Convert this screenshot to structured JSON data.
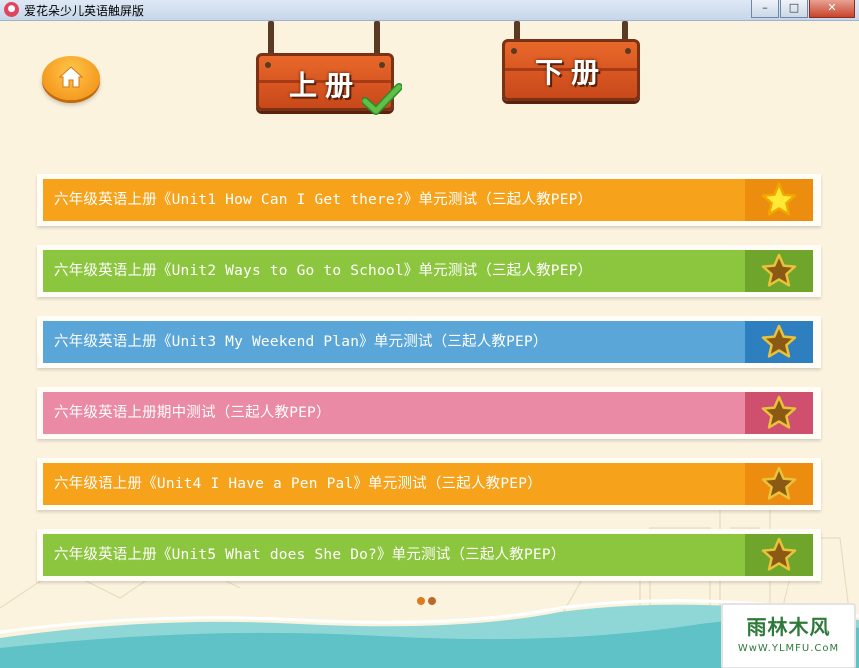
{
  "window": {
    "title": "爱花朵少儿英语触屏版",
    "minimize": "–",
    "maximize": "□",
    "close": "✕"
  },
  "books": {
    "upper": {
      "label": "上册",
      "selected": true
    },
    "lower": {
      "label": "下册",
      "selected": false
    }
  },
  "tests": [
    {
      "title": "六年级英语上册《Unit1 How Can I Get there?》单元测试（三起人教PEP）",
      "color": "#f7a21b",
      "star_bg": "#ec8d10",
      "starred": true
    },
    {
      "title": "六年级英语上册《Unit2 Ways to Go to School》单元测试（三起人教PEP）",
      "color": "#8cc63f",
      "star_bg": "#6fa52b",
      "starred": false
    },
    {
      "title": "六年级英语上册《Unit3 My Weekend Plan》单元测试（三起人教PEP）",
      "color": "#5aa6d8",
      "star_bg": "#2e7fc0",
      "starred": false
    },
    {
      "title": "六年级英语上册期中测试（三起人教PEP）",
      "color": "#ea8aa4",
      "star_bg": "#cf4f6e",
      "starred": false
    },
    {
      "title": "六年级语上册《Unit4 I Have a Pen Pal》单元测试（三起人教PEP）",
      "color": "#f7a21b",
      "star_bg": "#ec8d10",
      "starred": false
    },
    {
      "title": "六年级英语上册《Unit5 What does She Do?》单元测试（三起人教PEP）",
      "color": "#8cc63f",
      "star_bg": "#6fa52b",
      "starred": false
    }
  ],
  "pagination": {
    "active_color": "#e07a1a",
    "inactive_color": "#b96a2a"
  },
  "watermark": {
    "main": "雨林木风",
    "sub": "WwW.YLMFU.CoM"
  },
  "icons": {
    "home": "home-icon",
    "star": "star-icon",
    "check": "checkmark-icon"
  }
}
